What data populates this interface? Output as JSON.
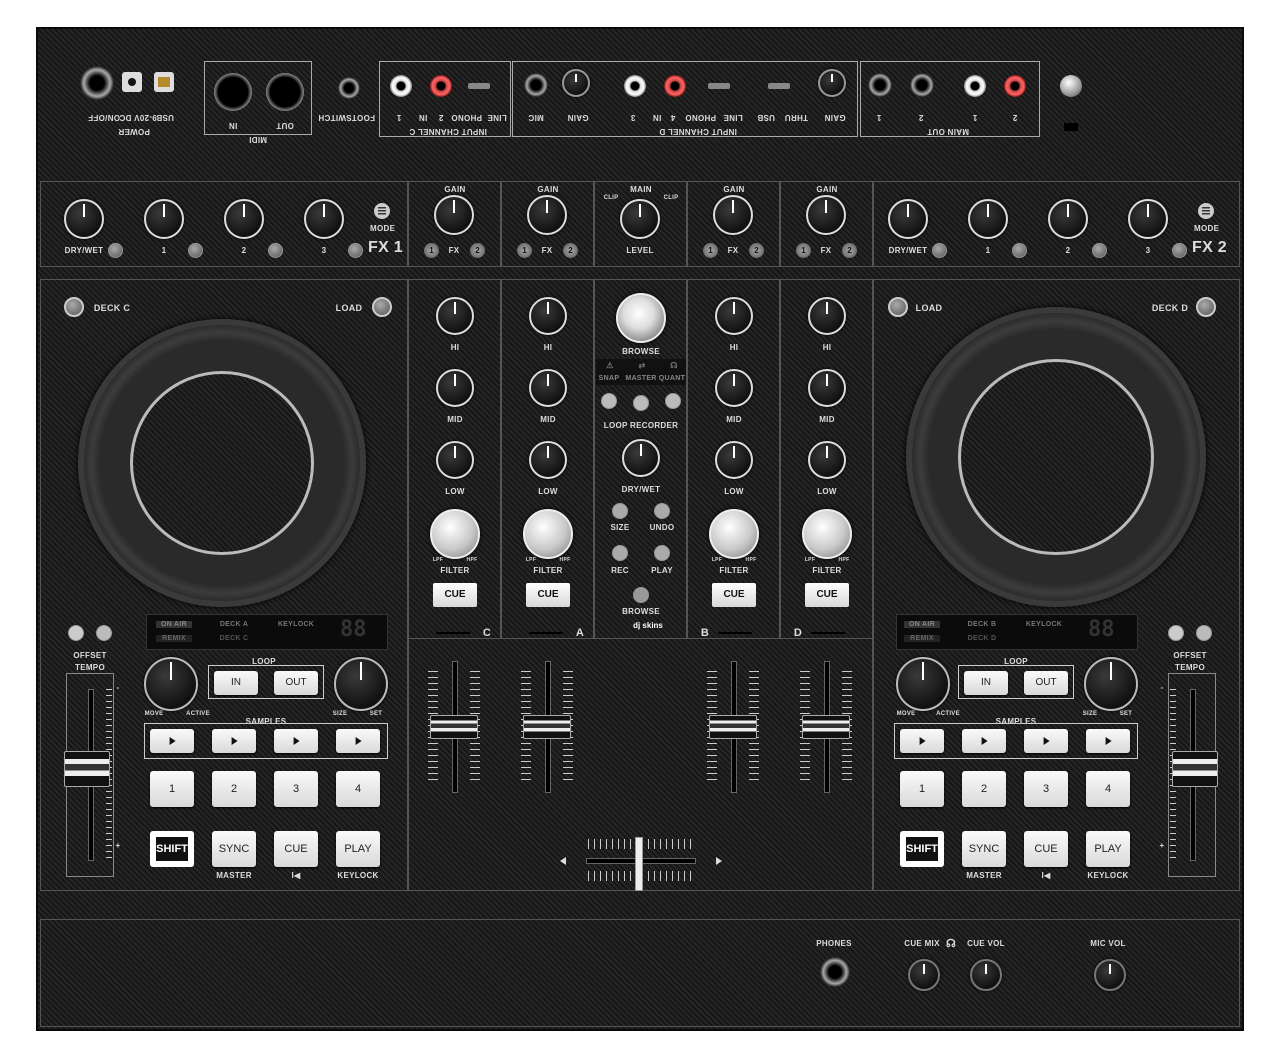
{
  "top_panel": {
    "power": {
      "on_off": "ON/OFF",
      "volt": "9-20V DC",
      "usb": "USB",
      "title": "POWER"
    },
    "midi": {
      "in": "IN",
      "out": "OUT",
      "title": "MIDI"
    },
    "footswitch": "FOOTSWITCH",
    "input_c": {
      "line": "LINE",
      "phono": "PHONO",
      "two": "2",
      "in": "IN",
      "one": "1",
      "title": "INPUT CHANNEL C"
    },
    "input_d": {
      "mic": "MIC",
      "gain": "GAIN",
      "three": "3",
      "in": "IN",
      "four": "4",
      "phono": "PHONO",
      "line": "LINE",
      "usb": "USB",
      "thru": "THRU",
      "gain2": "GAIN",
      "title": "INPUT CHANNEL D"
    },
    "main_out": {
      "one": "1",
      "two": "2",
      "one_b": "1",
      "two_b": "2",
      "title": "MAIN OUT"
    }
  },
  "fx1": {
    "dry_wet": "DRY/WET",
    "k1": "1",
    "k2": "2",
    "k3": "3",
    "mode": "MODE",
    "title": "FX 1"
  },
  "fx2": {
    "dry_wet": "DRY/WET",
    "k1": "1",
    "k2": "2",
    "k3": "3",
    "mode": "MODE",
    "title": "FX 2"
  },
  "gain_row": {
    "ch_c": {
      "gain": "GAIN",
      "fx": "FX",
      "b1": "1",
      "b2": "2"
    },
    "ch_a": {
      "gain": "GAIN",
      "fx": "FX",
      "b1": "1",
      "b2": "2"
    },
    "main": {
      "title": "MAIN",
      "clip_l": "CLIP",
      "clip_r": "CLIP",
      "level": "LEVEL"
    },
    "ch_b": {
      "gain": "GAIN",
      "fx": "FX",
      "b1": "1",
      "b2": "2"
    },
    "ch_d": {
      "gain": "GAIN",
      "fx": "FX",
      "b1": "1",
      "b2": "2"
    }
  },
  "deck_left": {
    "deck": "DECK C",
    "load": "LOAD",
    "display": {
      "on_air": "ON AIR",
      "deck_a": "DECK A",
      "keylock": "KEYLOCK",
      "remix": "REMIX",
      "deck_c": "DECK C",
      "digits": "88"
    },
    "offset": "OFFSET",
    "tempo": "TEMPO",
    "loop": "LOOP",
    "in": "IN",
    "out": "OUT",
    "move": "MOVE",
    "active": "ACTIVE",
    "size": "SIZE",
    "set": "SET",
    "samples": "SAMPLES",
    "pads": [
      "1",
      "2",
      "3",
      "4"
    ],
    "shift": "SHIFT",
    "sync": "SYNC",
    "cue": "CUE",
    "play": "PLAY",
    "master": "MASTER",
    "prev": "I◀",
    "keylock_sub": "KEYLOCK",
    "tempo_minus": "-",
    "tempo_plus": "+"
  },
  "deck_right": {
    "deck": "DECK D",
    "load": "LOAD",
    "display": {
      "on_air": "ON AIR",
      "deck_a": "DECK B",
      "keylock": "KEYLOCK",
      "remix": "REMIX",
      "deck_c": "DECK D",
      "digits": "88"
    },
    "offset": "OFFSET",
    "tempo": "TEMPO",
    "loop": "LOOP",
    "in": "IN",
    "out": "OUT",
    "move": "MOVE",
    "active": "ACTIVE",
    "size": "SIZE",
    "set": "SET",
    "samples": "SAMPLES",
    "pads": [
      "1",
      "2",
      "3",
      "4"
    ],
    "shift": "SHIFT",
    "sync": "SYNC",
    "cue": "CUE",
    "play": "PLAY",
    "master": "MASTER",
    "prev": "I◀",
    "keylock_sub": "KEYLOCK",
    "tempo_minus": "-",
    "tempo_plus": "+"
  },
  "mixer": {
    "channels": [
      {
        "hi": "HI",
        "mid": "MID",
        "low": "LOW",
        "filter": "FILTER",
        "lpf": "LPF",
        "hpf": "HPF",
        "cue": "CUE",
        "letter": "C"
      },
      {
        "hi": "HI",
        "mid": "MID",
        "low": "LOW",
        "filter": "FILTER",
        "lpf": "LPF",
        "hpf": "HPF",
        "cue": "CUE",
        "letter": "A"
      },
      {
        "hi": "HI",
        "mid": "MID",
        "low": "LOW",
        "filter": "FILTER",
        "lpf": "LPF",
        "hpf": "HPF",
        "cue": "CUE",
        "letter": "B"
      },
      {
        "hi": "HI",
        "mid": "MID",
        "low": "LOW",
        "filter": "FILTER",
        "lpf": "LPF",
        "hpf": "HPF",
        "cue": "CUE",
        "letter": "D"
      }
    ],
    "center": {
      "browse": "BROWSE",
      "snap": "SNAP",
      "master": "MASTER",
      "quant": "QUANT",
      "loop_recorder": "LOOP RECORDER",
      "dry_wet": "DRY/WET",
      "size": "SIZE",
      "undo": "UNDO",
      "rec": "REC",
      "play": "PLAY",
      "browse2": "BROWSE"
    },
    "logo": "dj skins"
  },
  "front": {
    "phones": "PHONES",
    "cue_mix": "CUE MIX",
    "cue_vol": "CUE VOL",
    "mic_vol": "MIC VOL"
  }
}
